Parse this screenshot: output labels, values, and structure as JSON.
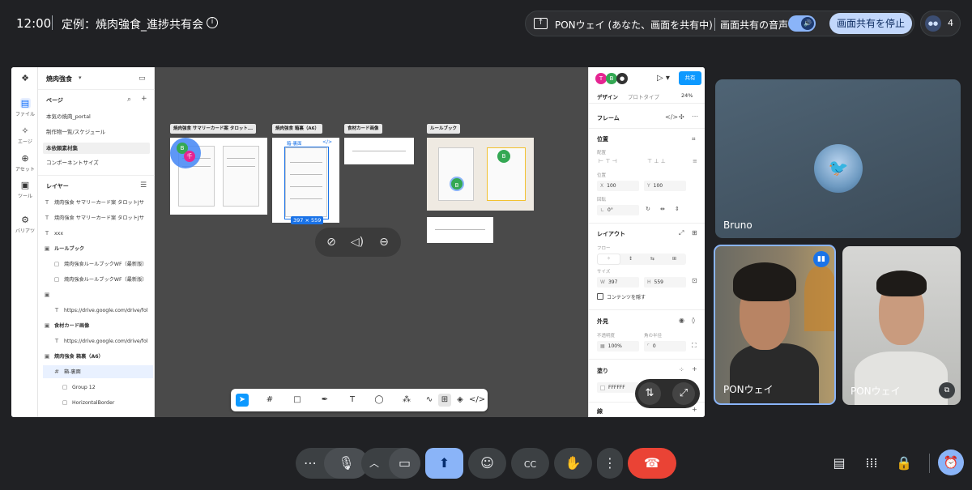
{
  "topbar": {
    "time": "12:00",
    "meeting_title": "定例：焼肉強食_進捗共有会",
    "info_icon": "info-icon",
    "share_status": "PONウェイ (あなた、画面を共有中)",
    "share_audio_label": "画面共有の音声",
    "stop_share_label": "画面共有を停止",
    "participant_count": "4"
  },
  "figma": {
    "rail": [
      {
        "label": "ファイル",
        "icon": "file-icon"
      },
      {
        "label": "エージ",
        "icon": "assets-icon"
      },
      {
        "label": "アセット",
        "icon": "plus-circle-icon"
      },
      {
        "label": "ツール",
        "icon": "toolbox-icon"
      },
      {
        "label": "バリアツ",
        "icon": "settings-icon"
      }
    ],
    "project_name": "焼肉強食",
    "pages_header": "ページ",
    "pages": [
      "本気の焼肉_portal",
      "制作物一覧/スケジュール",
      "本依頼素材集",
      "コンポーネントサイズ"
    ],
    "layers_header": "レイヤー",
    "layers": [
      {
        "icon": "T",
        "text": "焼肉強食 サマリーカード案 タロットJサ",
        "bold": false,
        "indent": 0
      },
      {
        "icon": "T",
        "text": "焼肉強食 サマリーカード案 タロットJサ",
        "bold": false,
        "indent": 0
      },
      {
        "icon": "T",
        "text": "xxx",
        "bold": false,
        "indent": 0
      },
      {
        "icon": "▣",
        "text": "ルールブック",
        "bold": true,
        "indent": 0
      },
      {
        "icon": "▢",
        "text": "焼肉強食ルールブックWF（最新版）",
        "bold": false,
        "indent": 1
      },
      {
        "icon": "▢",
        "text": "焼肉強食ルールブックWF（最新版）",
        "bold": false,
        "indent": 1
      },
      {
        "icon": "▣",
        "text": "",
        "bold": false,
        "indent": 0
      },
      {
        "icon": "T",
        "text": "https://drive.google.com/drive/fol",
        "bold": false,
        "indent": 1
      },
      {
        "icon": "▣",
        "text": "食材カード画像",
        "bold": true,
        "indent": 0
      },
      {
        "icon": "T",
        "text": "https://drive.google.com/drive/fol",
        "bold": false,
        "indent": 1
      },
      {
        "icon": "▣",
        "text": "焼肉強食 箱裏（A6）",
        "bold": true,
        "indent": 0
      },
      {
        "icon": "#",
        "text": "箱-裏面",
        "bold": false,
        "indent": 1,
        "selected": true
      },
      {
        "icon": "▢",
        "text": "Group 12",
        "bold": false,
        "indent": 2
      },
      {
        "icon": "▢",
        "text": "HorizontalBorder",
        "bold": false,
        "indent": 2
      }
    ],
    "canvas": {
      "frames": [
        {
          "label": "焼肉強食 サマリーカード案 タロット..."
        },
        {
          "label": "焼肉強食 箱裏（A6）"
        },
        {
          "label": "食材カード画像"
        },
        {
          "label": "ルールブック"
        }
      ],
      "inner_label": "箱-裏面",
      "selection_size": "397 × 559",
      "cursors": [
        "B",
        "千",
        "B",
        "B"
      ]
    },
    "right": {
      "avatars": [
        "T",
        "B"
      ],
      "share_label": "共有",
      "tab_design": "デザイン",
      "tab_prototype": "プロトタイプ",
      "zoom": "24%",
      "frame_label": "フレーム",
      "position_header": "位置",
      "align_label": "配置",
      "position_label": "位置",
      "x_label": "X",
      "x_value": "100",
      "y_label": "Y",
      "y_value": "100",
      "rotation_label": "回転",
      "rotation_value": "0°",
      "layout_header": "レイアウト",
      "flow_label": "フロー",
      "size_label": "サイズ",
      "w_label": "W",
      "w_value": "397",
      "h_label": "H",
      "h_value": "559",
      "clip_label": "コンテンツを隠す",
      "appearance_header": "外見",
      "opacity_label": "不透明度",
      "radius_label": "角の半径",
      "opacity_value": "100%",
      "radius_value": "0",
      "fill_header": "塗り",
      "fill_value": "FFFFFF",
      "stroke_header": "線"
    }
  },
  "tiles": [
    {
      "name": "Bruno"
    },
    {
      "name": "PONウェイ"
    },
    {
      "name": "PONウェイ"
    }
  ],
  "controls": {
    "more_options": "more-options-icon",
    "mic": "mic-icon",
    "camera": "camera-icon",
    "present": "present-icon",
    "emoji": "emoji-icon",
    "captions": "captions-icon",
    "hand": "hand-icon",
    "end_call": "end-call-icon"
  }
}
